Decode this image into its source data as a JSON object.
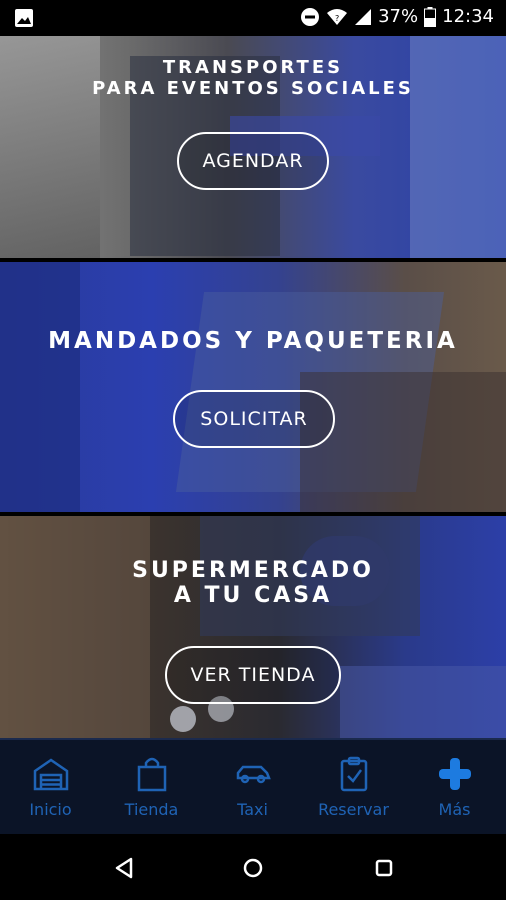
{
  "status_bar": {
    "battery_percent": "37%",
    "time": "12:34"
  },
  "panels": [
    {
      "title": "TRANSPORTES\nPARA EVENTOS SOCIALES",
      "button": "AGENDAR"
    },
    {
      "title": "MANDADOS Y PAQUETERIA",
      "button": "SOLICITAR"
    },
    {
      "title": "SUPERMERCADO\nA TU CASA",
      "button": "VER TIENDA"
    }
  ],
  "bottom_nav": {
    "items": [
      {
        "label": "Inicio",
        "icon": "warehouse-icon"
      },
      {
        "label": "Tienda",
        "icon": "shopping-bag-icon"
      },
      {
        "label": "Taxi",
        "icon": "car-icon"
      },
      {
        "label": "Reservar",
        "icon": "clipboard-check-icon"
      },
      {
        "label": "Más",
        "icon": "plus-icon"
      }
    ],
    "label_color": "#1f63b5",
    "active_icon_color": "#1d7be0",
    "background": "#0b1427"
  },
  "android_nav": [
    "back-icon",
    "home-icon",
    "recents-icon"
  ]
}
